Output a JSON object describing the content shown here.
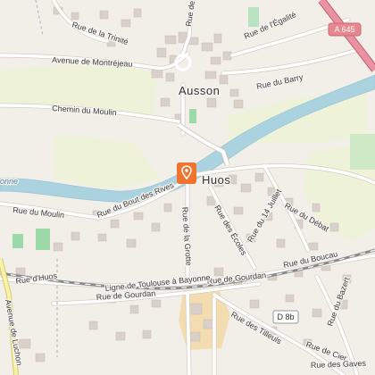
{
  "map": {
    "towns": [
      {
        "name": "Ausson"
      },
      {
        "name": "Huos"
      }
    ],
    "streets": [
      "Rue de la Trinité",
      "Avenue de Montréjeau",
      "Rue de l'École",
      "Rue de l'Égalité",
      "Rue du Barry",
      "Chemin du Moulin",
      "Rue du Bout des Rives",
      "Rue du Moulin",
      "Rue de la Grotte",
      "Rue des Écoles",
      "Rue du 14 Juillet",
      "Rue du Débat",
      "Rue du Boucau",
      "Rue d'Huos",
      "Rue de Gourdan",
      "Rue de Gourdan",
      "Rue des Tilleuls",
      "Rue du Bazert",
      "Rue de Cier",
      "Avenue de Luchon",
      "Rue des Gaves",
      "Ligne de Toulouse à Bayonne",
      "onne"
    ],
    "route_shields": [
      {
        "ref": "A 645",
        "color": "#e8878f",
        "text_color": "#ffffff"
      },
      {
        "ref": "D 8b",
        "color": "#ffffff",
        "text_color": "#333333"
      }
    ],
    "marker": {
      "icon": "map-pin-icon",
      "color": "#f0742e"
    },
    "colors": {
      "background": "#f2efe9",
      "river": "#aad3df",
      "meadow": "#e9f0cf",
      "park": "#9dd8a9",
      "school": "#f0d9a8",
      "building": "#d9d0c9",
      "road": "#ffffff",
      "motorway": "#e892a2",
      "railway": "#888888"
    }
  }
}
